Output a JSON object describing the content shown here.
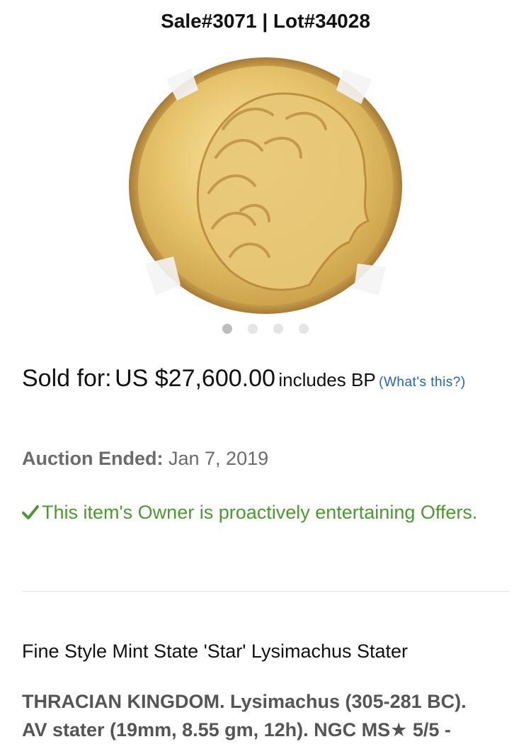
{
  "header": {
    "title": "Sale#3071 | Lot#34028"
  },
  "image": {
    "alt": "gold-coin-obverse",
    "icon": "coin-photo"
  },
  "carousel": {
    "count": 4,
    "active": 0
  },
  "price": {
    "sold_label": "Sold for:",
    "sold_value": "US $27,600.00",
    "bp_label": "includes BP",
    "whats_this": "(What's this?)"
  },
  "auction": {
    "ended_label": "Auction Ended:",
    "ended_date": "Jan 7, 2019"
  },
  "offers": {
    "text": "This item's Owner is proactively entertaining Offers.",
    "icon": "checkmark-icon"
  },
  "lot": {
    "title": "Fine Style Mint State 'Star' Lysimachus Stater",
    "line1": "THRACIAN KINGDOM. Lysimachus (305-281 BC).",
    "line2": "AV stater (19mm, 8.55 gm, 12h). NGC MS★ 5/5 -"
  },
  "colors": {
    "link": "#1e63c4",
    "success": "#4a9a2e",
    "muted": "#6b6b6b"
  }
}
